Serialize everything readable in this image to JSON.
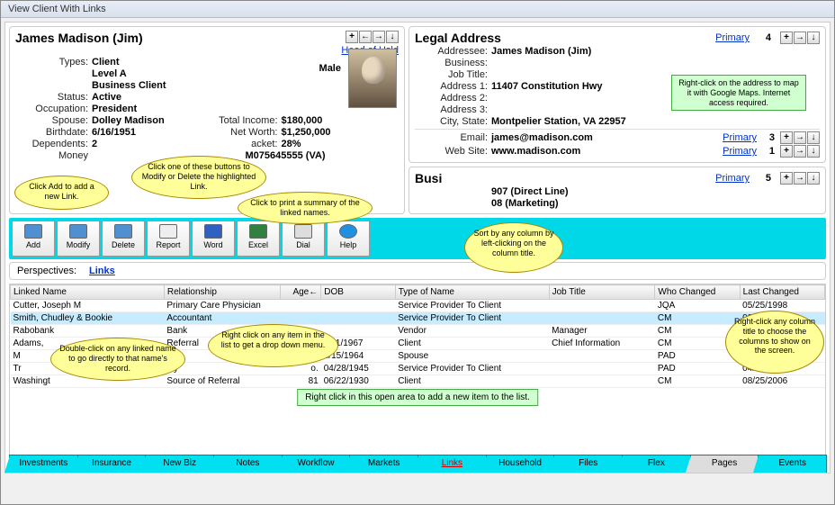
{
  "window": {
    "title": "View Client With Links"
  },
  "client": {
    "name": "James Madison (Jim)",
    "head_link": "Head of Hsld",
    "gender": "Male",
    "types_label": "Types:",
    "types": [
      "Client",
      "Level A",
      "Business Client"
    ],
    "status_label": "Status:",
    "status": "Active",
    "occupation_label": "Occupation:",
    "occupation": "President",
    "spouse_label": "Spouse:",
    "spouse": "Dolley Madison",
    "birthdate_label": "Birthdate:",
    "birthdate": "6/16/1951",
    "dependents_label": "Dependents:",
    "dependents": "2",
    "money_label": "Money",
    "total_income_label": "Total Income:",
    "total_income": "$180,000",
    "net_worth_label": "Net Worth:",
    "net_worth": "$1,250,000",
    "bracket_label": "acket:",
    "bracket": "28%",
    "phone_partial": "M075645555 (VA)"
  },
  "nav_icons": [
    "+",
    "←",
    "→",
    "↓"
  ],
  "address": {
    "heading": "Legal Address",
    "primary": "Primary",
    "count": "4",
    "addressee_label": "Addressee:",
    "addressee": "James Madison (Jim)",
    "business_label": "Business:",
    "jobtitle_label": "Job Title:",
    "addr1_label": "Address 1:",
    "addr1": "11407 Constitution Hwy",
    "addr2_label": "Address 2:",
    "addr3_label": "Address 3:",
    "city_label": "City, State:",
    "city": "Montpelier Station,   VA   22957"
  },
  "contacts": [
    {
      "label": "Email:",
      "value": "james@madison.com",
      "primary": "Primary",
      "count": "3"
    },
    {
      "label": "Web Site:",
      "value": "www.madison.com",
      "primary": "Primary",
      "count": "1"
    }
  ],
  "business": {
    "heading": "Busi",
    "primary": "Primary",
    "count": "5",
    "lines": [
      "907  (Direct Line)",
      "08  (Marketing)"
    ]
  },
  "toolbar": [
    "Add",
    "Modify",
    "Delete",
    "Report",
    "Word",
    "Excel",
    "Dial",
    "Help"
  ],
  "perspectives": {
    "label": "Perspectives:",
    "link": "Links"
  },
  "table": {
    "cols": [
      "Linked Name",
      "Relationship",
      "Age←",
      "DOB",
      "Type of Name",
      "Job Title",
      "Who Changed",
      "Last Changed"
    ],
    "rows": [
      {
        "name": "Cutter, Joseph M",
        "rel": "Primary Care Physician",
        "age": "",
        "dob": "",
        "type": "Service Provider To Client",
        "job": "",
        "who": "JQA",
        "last": "05/25/1998"
      },
      {
        "name": "Smith, Chudley & Bookie",
        "rel": "Accountant",
        "age": "",
        "dob": "",
        "type": "Service Provider To Client",
        "job": "",
        "who": "CM",
        "last": "09/25/2003",
        "sel": true
      },
      {
        "name": "Rabobank",
        "rel": "Bank",
        "age": "",
        "dob": "",
        "type": "Vendor",
        "job": "Manager",
        "who": "CM",
        "last": "09/25/2003"
      },
      {
        "name": "Adams,",
        "rel": "Referral",
        "age": "",
        "dob": "0/11/1967",
        "type": "Client",
        "job": "Chief Information",
        "who": "CM",
        "last": "08/25/2006"
      },
      {
        "name": "M",
        "rel": "",
        "age": "",
        "dob": "3/15/1964",
        "type": "Spouse",
        "job": "",
        "who": "PAD",
        "last": "11/13/1994"
      },
      {
        "name": "Tr",
        "rel": "ley",
        "age": "o.",
        "dob": "04/28/1945",
        "type": "Service Provider To Client",
        "job": "",
        "who": "PAD",
        "last": "04/03/1999"
      },
      {
        "name": "Washingt",
        "rel": "Source of Referral",
        "age": "81",
        "dob": "06/22/1930",
        "type": "Client",
        "job": "",
        "who": "CM",
        "last": "08/25/2006"
      }
    ]
  },
  "callouts": {
    "add": "Click Add to add a new Link.",
    "moddel": "Click one of these buttons to Modify or Delete the highlighted Link.",
    "print": "Click to print a summary of the linked names.",
    "dbl": "Double-click on any linked name to go directly to that name's record.",
    "right": "Right click on any item in the list to get a drop down menu.",
    "sort": "Sort by any column by left-clicking on the column title.",
    "cols": "Right-click any column title to choose the columns to show on the screen.",
    "addr": "Right-click on the address to map it with Google Maps. Internet access required.",
    "empty": "Right click in this open area to add a new item to the list."
  },
  "tabs": [
    "Investments",
    "Insurance",
    "New Biz",
    "Notes",
    "Workflow",
    "Markets",
    "Links",
    "Household",
    "Files",
    "Flex",
    "Pages",
    "Events"
  ]
}
